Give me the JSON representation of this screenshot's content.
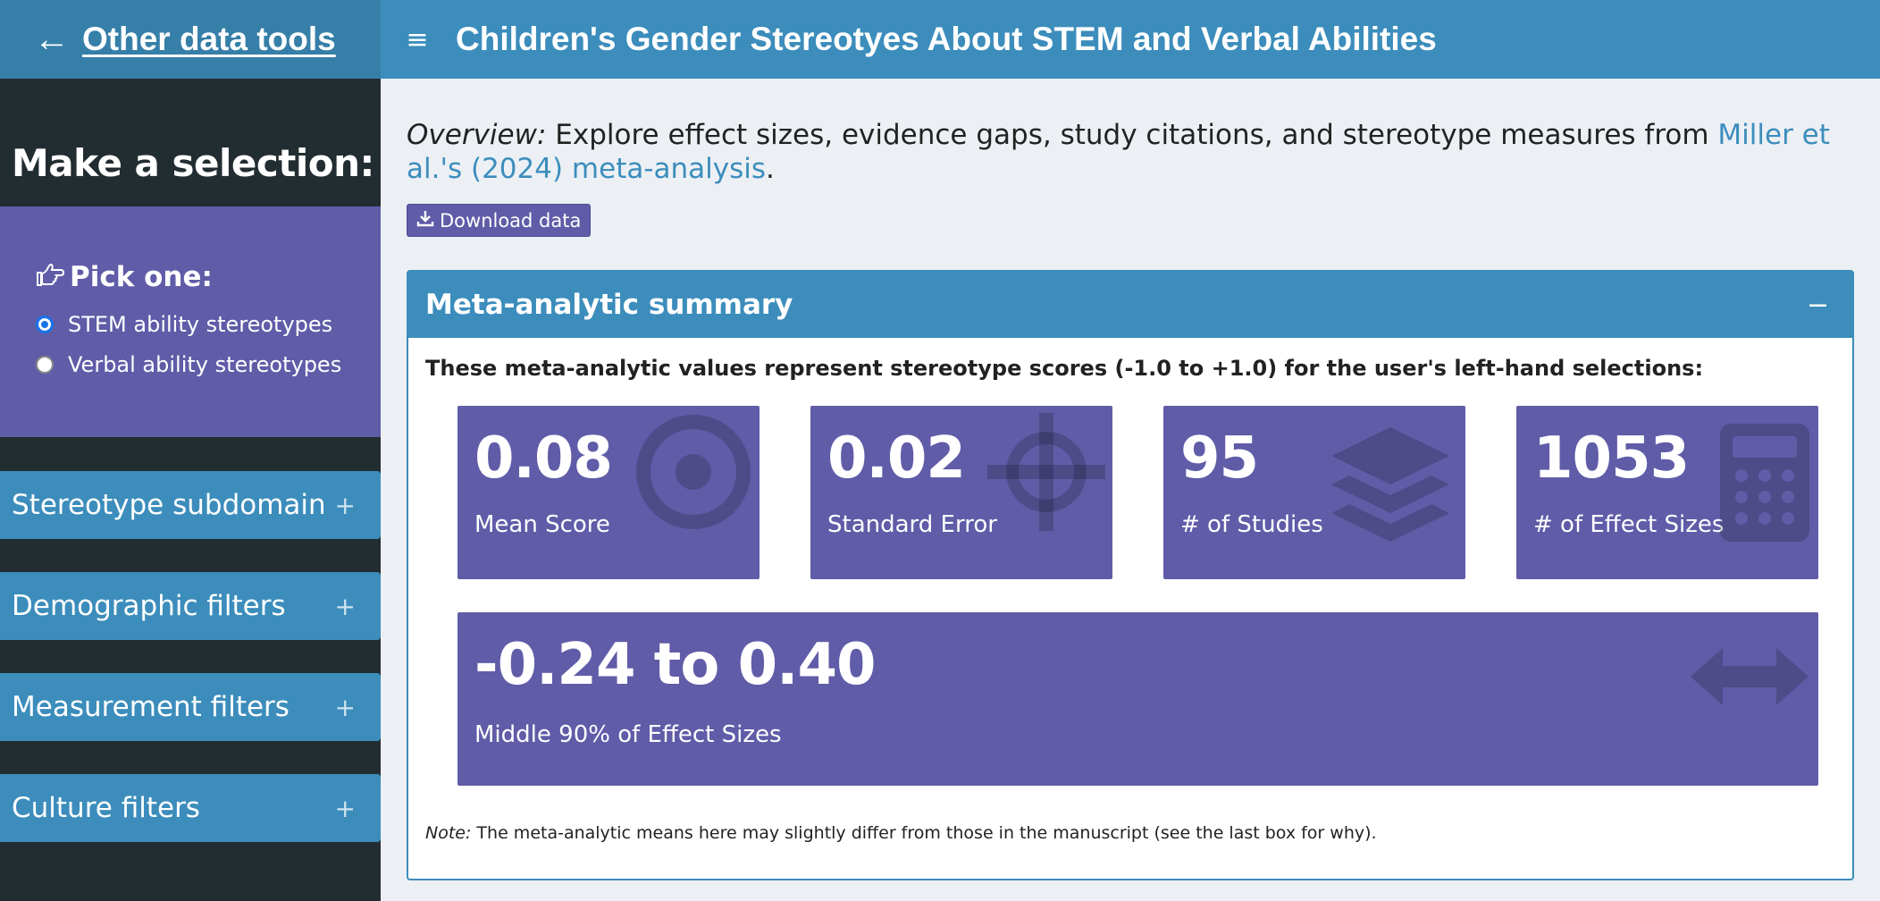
{
  "header": {
    "back_arrow": "←",
    "back_link": "Other data tools",
    "menu_icon": "hamburger-icon",
    "title": "Children's Gender Stereotyes About STEM and Verbal Abilities"
  },
  "sidebar": {
    "heading": "Make a selection:",
    "pick": {
      "title": "Pick one:",
      "icon": "hand-pointer-icon",
      "options": [
        {
          "label": "STEM ability stereotypes",
          "checked": true
        },
        {
          "label": "Verbal ability stereotypes",
          "checked": false
        }
      ]
    },
    "accordions": [
      {
        "label": "Stereotype subdomain",
        "icon": "+"
      },
      {
        "label": "Demographic filters",
        "icon": "+"
      },
      {
        "label": "Measurement filters",
        "icon": "+"
      },
      {
        "label": "Culture filters",
        "icon": "+"
      }
    ]
  },
  "main": {
    "overview_label": "Overview:",
    "overview_text": " Explore effect sizes, evidence gaps, study citations, and stereotype measures from ",
    "overview_link": "Miller et al.'s (2024) meta-analysis",
    "overview_end": ".",
    "download_label": "Download data",
    "panel": {
      "title": "Meta-analytic summary",
      "collapse_icon": "−",
      "lead": "These meta-analytic values represent stereotype scores (-1.0 to +1.0) for the user's left-hand selections:",
      "boxes": [
        {
          "value": "0.08",
          "label": "Mean Score",
          "icon": "bullseye-icon"
        },
        {
          "value": "0.02",
          "label": "Standard Error",
          "icon": "crosshairs-icon"
        },
        {
          "value": "95",
          "label": "# of Studies",
          "icon": "layers-icon"
        },
        {
          "value": "1053",
          "label": "# of Effect Sizes",
          "icon": "calculator-icon"
        }
      ],
      "range_box": {
        "value": "-0.24 to 0.40",
        "label": "Middle 90% of Effect Sizes",
        "icon": "arrows-horizontal-icon"
      },
      "note_label": "Note:",
      "note_text": " The meta-analytic means here may slightly differ from those in the manuscript (see the last box for why)."
    }
  },
  "colors": {
    "header_dark": "#367fa9",
    "header": "#3c8dbc",
    "sidebar": "#222d32",
    "purple": "#605ca8",
    "content_bg": "#ecf0f5"
  }
}
